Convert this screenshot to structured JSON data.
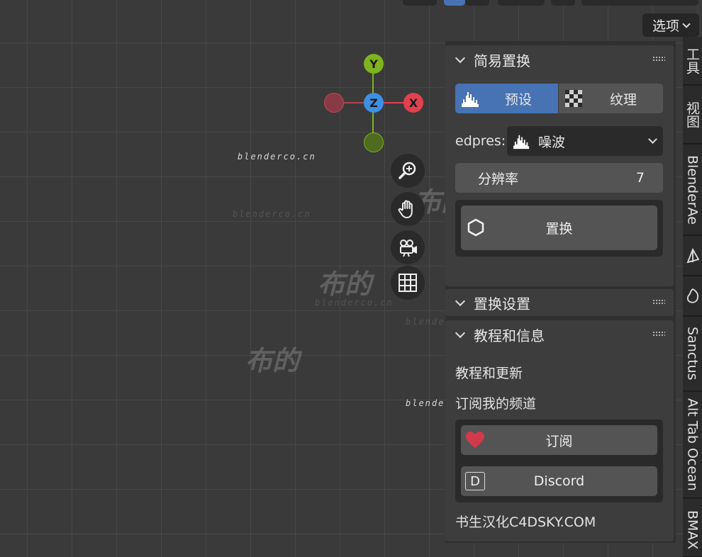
{
  "header": {
    "options_label": "选项"
  },
  "watermarks": {
    "site": "blenderco.cn",
    "brand": "布的"
  },
  "gizmo": {
    "y_label": "Y",
    "z_label": "Z",
    "x_label": "X"
  },
  "nav_icons": [
    "zoom-icon",
    "hand-pan-icon",
    "camera-icon",
    "grid-icon"
  ],
  "sidebar_tabs": [
    "工具",
    "视图",
    "BlenderAe",
    "",
    "",
    "Sanctus",
    "Alt Tab Ocean",
    "BMAX"
  ],
  "panel_easy_displace": {
    "title": "简易置换",
    "tabs": [
      {
        "label": "预设",
        "active": true,
        "icon": "histogram-icon"
      },
      {
        "label": "纹理",
        "active": false,
        "icon": "checker-icon"
      }
    ],
    "preset_label": "edpres:",
    "preset_value": "噪波",
    "resolution_label": "分辨率",
    "resolution_value": "7",
    "displace_button": "置换"
  },
  "panel_displace_settings": {
    "title": "置换设置"
  },
  "panel_tutorials": {
    "title": "教程和信息",
    "line1": "教程和更新",
    "line2": "订阅我的频道",
    "subscribe_button": "订阅",
    "discord_button": "Discord",
    "footer": "书生汉化C4DSKY.COM"
  },
  "colors": {
    "accent_blue": "#4772b3",
    "axis_x": "#e0414f",
    "axis_y": "#7fb31e",
    "axis_z": "#3d8fe6",
    "heart": "#d2394c"
  }
}
